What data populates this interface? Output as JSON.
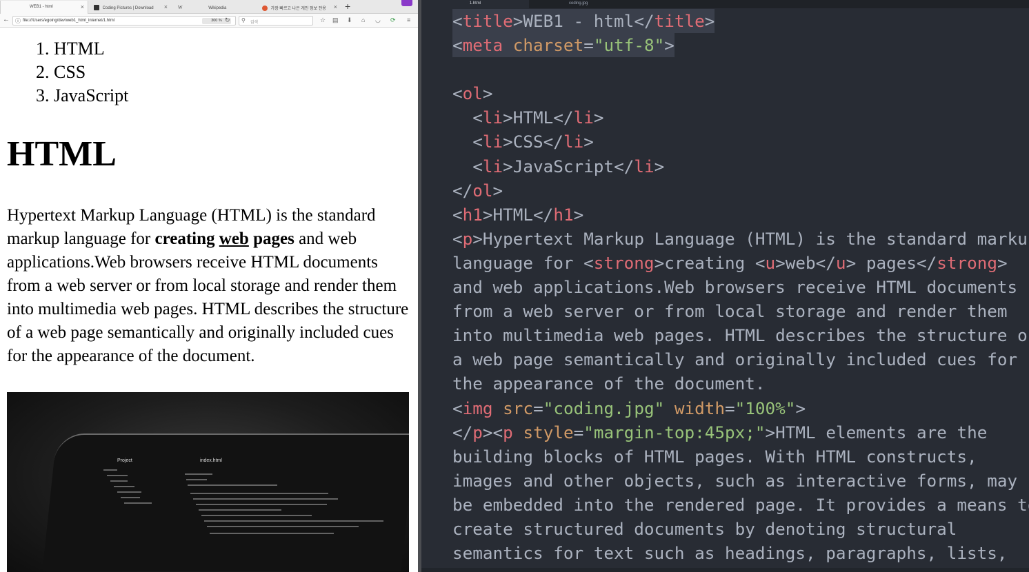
{
  "browser": {
    "tabs": [
      {
        "label": "WEB1 - html",
        "active": true
      },
      {
        "label": "Coding Pictures | Download",
        "active": false
      },
      {
        "label": "W",
        "active": false
      },
      {
        "label": "Wikipedia",
        "active": false
      },
      {
        "label": "가장 빠르고 나은 개인 정보 전용",
        "active": false
      }
    ],
    "url": "file:///Users/egoing/dev/web1_html_internet/1.html",
    "zoom": "300 %",
    "search_placeholder": "검색"
  },
  "page": {
    "list_items": [
      "1. HTML",
      "2. CSS",
      "3. JavaScript"
    ],
    "heading": "HTML",
    "paragraph": {
      "before": "Hypertext Markup Language (HTML) is the standard markup language for ",
      "strong_before": "creating ",
      "underlined": "web",
      "strong_after": " pages",
      "after": " and web applications.Web browsers receive HTML documents from a web server or from local storage and render them into multimedia web pages. HTML describes the structure of a web page semantically and originally included cues for the appearance of the document."
    },
    "photo_labels": {
      "left": "Project",
      "right": "index.html"
    }
  },
  "editor": {
    "tabs": [
      "1.html",
      "coding.jpg"
    ],
    "lines": [
      [
        {
          "t": "<",
          "c": ""
        },
        {
          "t": "title",
          "c": "tg"
        },
        {
          "t": ">WEB1 - html</",
          "c": ""
        },
        {
          "t": "title",
          "c": "tg"
        },
        {
          "t": ">",
          "c": ""
        }
      ],
      [
        {
          "t": "<",
          "c": ""
        },
        {
          "t": "meta",
          "c": "tg"
        },
        {
          "t": " ",
          "c": ""
        },
        {
          "t": "charset",
          "c": "at"
        },
        {
          "t": "=",
          "c": ""
        },
        {
          "t": "\"utf-8\"",
          "c": "st"
        },
        {
          "t": ">",
          "c": ""
        }
      ],
      [],
      [
        {
          "t": "<",
          "c": ""
        },
        {
          "t": "ol",
          "c": "tg"
        },
        {
          "t": ">",
          "c": ""
        }
      ],
      [
        {
          "t": "  <",
          "c": ""
        },
        {
          "t": "li",
          "c": "tg"
        },
        {
          "t": ">HTML</",
          "c": ""
        },
        {
          "t": "li",
          "c": "tg"
        },
        {
          "t": ">",
          "c": ""
        }
      ],
      [
        {
          "t": "  <",
          "c": ""
        },
        {
          "t": "li",
          "c": "tg"
        },
        {
          "t": ">CSS</",
          "c": ""
        },
        {
          "t": "li",
          "c": "tg"
        },
        {
          "t": ">",
          "c": ""
        }
      ],
      [
        {
          "t": "  <",
          "c": ""
        },
        {
          "t": "li",
          "c": "tg"
        },
        {
          "t": ">JavaScript</",
          "c": ""
        },
        {
          "t": "li",
          "c": "tg"
        },
        {
          "t": ">",
          "c": ""
        }
      ],
      [
        {
          "t": "</",
          "c": ""
        },
        {
          "t": "ol",
          "c": "tg"
        },
        {
          "t": ">",
          "c": ""
        }
      ],
      [
        {
          "t": "<",
          "c": ""
        },
        {
          "t": "h1",
          "c": "tg"
        },
        {
          "t": ">HTML</",
          "c": ""
        },
        {
          "t": "h1",
          "c": "tg"
        },
        {
          "t": ">",
          "c": ""
        }
      ],
      [
        {
          "t": "<",
          "c": ""
        },
        {
          "t": "p",
          "c": "tg"
        },
        {
          "t": ">Hypertext Markup Language (HTML) is the standard markup",
          "c": ""
        }
      ],
      [
        {
          "t": "language for <",
          "c": ""
        },
        {
          "t": "strong",
          "c": "tg"
        },
        {
          "t": ">creating <",
          "c": ""
        },
        {
          "t": "u",
          "c": "tg"
        },
        {
          "t": ">web</",
          "c": ""
        },
        {
          "t": "u",
          "c": "tg"
        },
        {
          "t": "> pages</",
          "c": ""
        },
        {
          "t": "strong",
          "c": "tg"
        },
        {
          "t": ">",
          "c": ""
        }
      ],
      [
        {
          "t": "and web applications.Web browsers receive HTML documents",
          "c": ""
        }
      ],
      [
        {
          "t": "from a web server or from local storage and render them",
          "c": ""
        }
      ],
      [
        {
          "t": "into multimedia web pages. HTML describes the structure of",
          "c": ""
        }
      ],
      [
        {
          "t": "a web page semantically and originally included cues for",
          "c": ""
        }
      ],
      [
        {
          "t": "the appearance of the document.",
          "c": ""
        }
      ],
      [
        {
          "t": "<",
          "c": ""
        },
        {
          "t": "img",
          "c": "tg"
        },
        {
          "t": " ",
          "c": ""
        },
        {
          "t": "src",
          "c": "at"
        },
        {
          "t": "=",
          "c": ""
        },
        {
          "t": "\"coding.jpg\"",
          "c": "st"
        },
        {
          "t": " ",
          "c": ""
        },
        {
          "t": "width",
          "c": "at"
        },
        {
          "t": "=",
          "c": ""
        },
        {
          "t": "\"100%\"",
          "c": "st"
        },
        {
          "t": ">",
          "c": ""
        }
      ],
      [
        {
          "t": "</",
          "c": ""
        },
        {
          "t": "p",
          "c": "tg"
        },
        {
          "t": "><",
          "c": ""
        },
        {
          "t": "p",
          "c": "tg"
        },
        {
          "t": " ",
          "c": ""
        },
        {
          "t": "style",
          "c": "at"
        },
        {
          "t": "=",
          "c": ""
        },
        {
          "t": "\"margin-top:45px;\"",
          "c": "st"
        },
        {
          "t": ">HTML elements are the",
          "c": ""
        }
      ],
      [
        {
          "t": "building blocks of HTML pages. With HTML constructs,",
          "c": ""
        }
      ],
      [
        {
          "t": "images and other objects, such as interactive forms, may",
          "c": ""
        }
      ],
      [
        {
          "t": "be embedded into the rendered page. It provides a means to",
          "c": ""
        }
      ],
      [
        {
          "t": "create structured documents by denoting structural",
          "c": ""
        }
      ],
      [
        {
          "t": "semantics for text such as headings, paragraphs, lists,",
          "c": ""
        }
      ]
    ]
  }
}
